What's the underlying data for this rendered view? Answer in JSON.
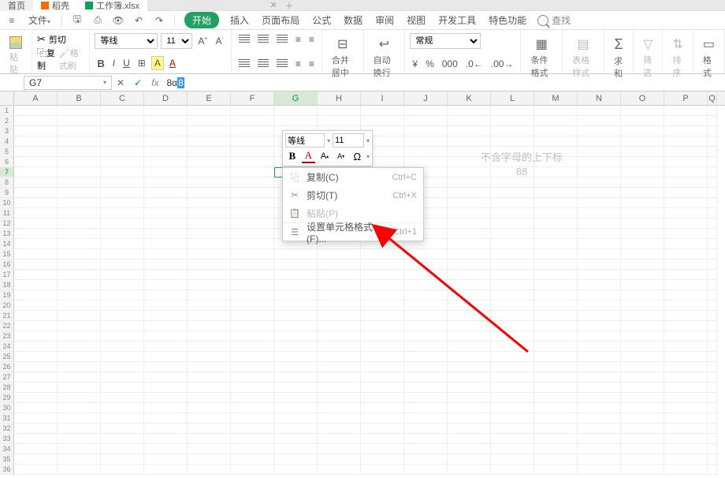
{
  "tabs": {
    "home": "首页",
    "dangke": "稻壳",
    "workbook": "工作簿.xlsx"
  },
  "menu": {
    "file": "文件",
    "kaishi": "开始",
    "charu": "插入",
    "yemian": "页面布局",
    "gongshi": "公式",
    "shuju": "数据",
    "shenyue": "审阅",
    "shitu": "视图",
    "kaifa": "开发工具",
    "teshe": "特色功能",
    "search": "查找"
  },
  "ribbon": {
    "paste": "粘贴",
    "cut": "剪切",
    "copy": "复制",
    "brush": "格式刷",
    "fontName": "等线",
    "fontSize": "11",
    "merge": "合并居中",
    "wrap": "自动换行",
    "numFormat": "常规",
    "condFmt": "条件格式",
    "tblFmt": "表格样式",
    "sum": "求和",
    "filter": "筛选",
    "sort": "排序",
    "format": "格式"
  },
  "formula": {
    "cellRef": "G7",
    "prefix": "8α",
    "selected": "8"
  },
  "columns": [
    "A",
    "B",
    "C",
    "D",
    "E",
    "F",
    "G",
    "H",
    "I",
    "J",
    "K",
    "L",
    "M",
    "N",
    "O",
    "P",
    "Q"
  ],
  "activeCell": {
    "row": 7,
    "col": "G",
    "value": "8α"
  },
  "miniToolbar": {
    "fontName": "等线",
    "fontSize": "11"
  },
  "contextMenu": {
    "copy": "复制(C)",
    "copyKey": "Ctrl+C",
    "cut": "剪切(T)",
    "cutKey": "Ctrl+X",
    "paste": "粘贴(P)",
    "format": "设置单元格格式(F)...",
    "formatKey": "Ctrl+1"
  },
  "annotation": {
    "line1": "不含字母的上下标",
    "line2": "88"
  }
}
